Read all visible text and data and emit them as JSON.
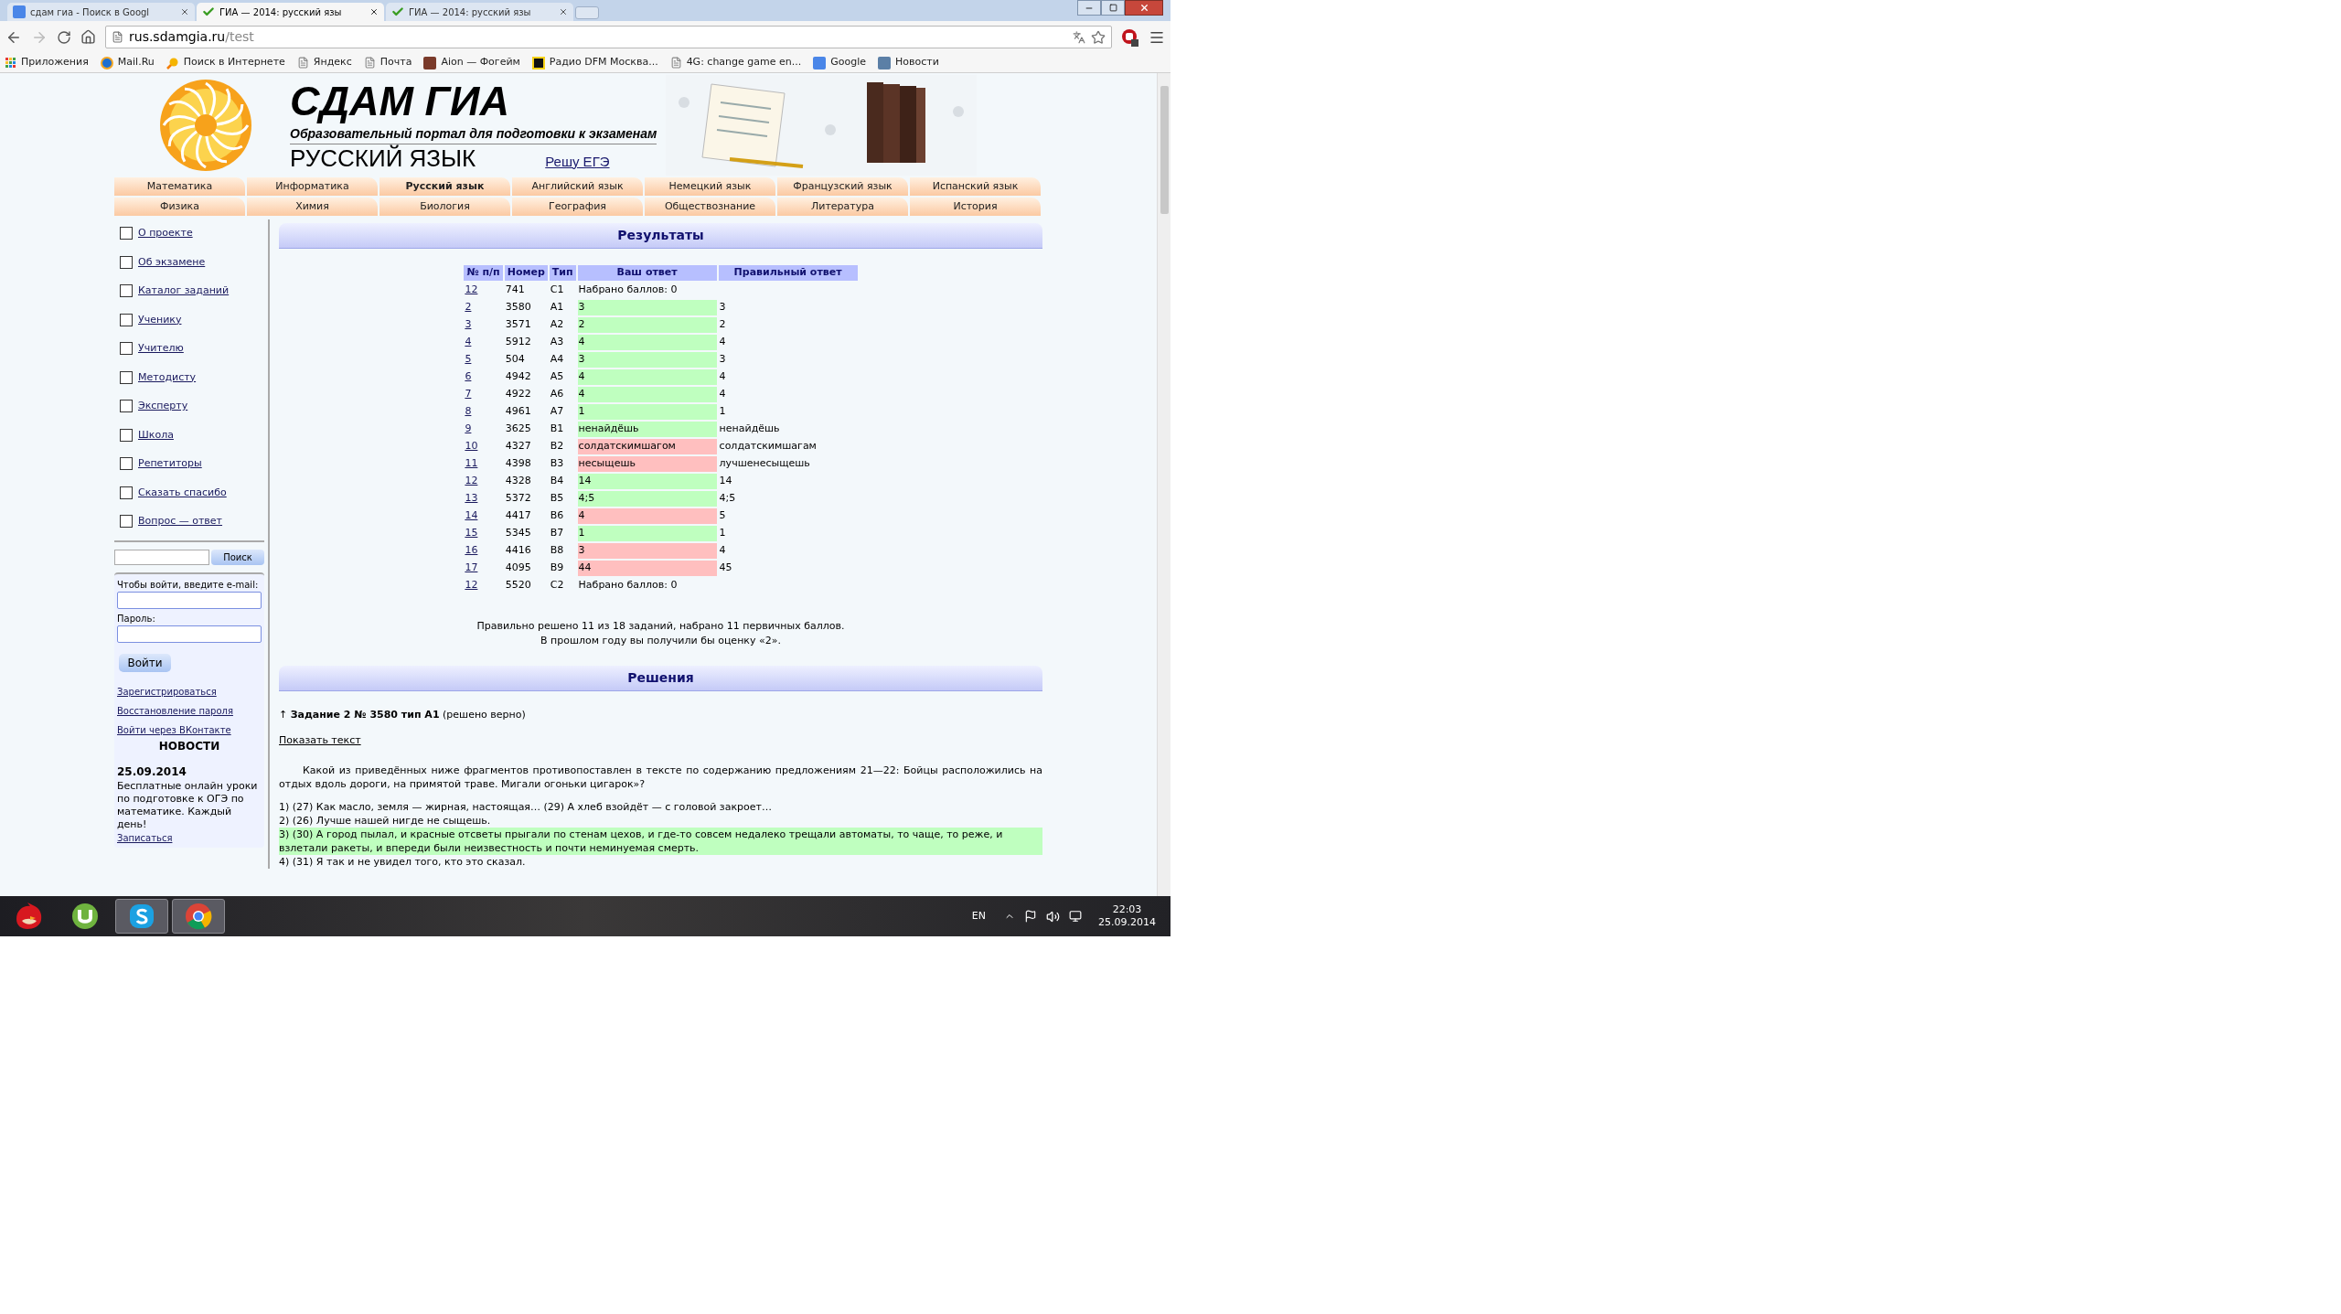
{
  "browser": {
    "tabs": [
      {
        "title": "сдам гиа - Поиск в Googl",
        "kind": "google",
        "selected": false
      },
      {
        "title": "ГИА — 2014: русский язы",
        "kind": "check",
        "selected": true
      },
      {
        "title": "ГИА — 2014: русский язы",
        "kind": "check",
        "selected": false
      }
    ],
    "url_host": "rus.sdamgia.ru",
    "url_path": "/test",
    "bookmarks": [
      {
        "label": "Приложения",
        "kind": "apps"
      },
      {
        "label": "Mail.Ru",
        "kind": "mail"
      },
      {
        "label": "Поиск в Интернете",
        "kind": "search"
      },
      {
        "label": "Яндекс",
        "kind": "page"
      },
      {
        "label": "Почта",
        "kind": "page"
      },
      {
        "label": "Aion — Фогейм",
        "kind": "game"
      },
      {
        "label": "Радио DFM Москва...",
        "kind": "radio"
      },
      {
        "label": "4G: change game en...",
        "kind": "page"
      },
      {
        "label": "Google",
        "kind": "google"
      },
      {
        "label": "Новости",
        "kind": "vk"
      }
    ]
  },
  "header": {
    "title": "СДАМ ГИА",
    "subtitle": "Образовательный портал для подготовки к экзаменам",
    "subject": "РУССКИЙ ЯЗЫК",
    "link": "Решу ЕГЭ"
  },
  "nav": [
    [
      {
        "label": "Математика",
        "selected": false
      },
      {
        "label": "Информатика",
        "selected": false
      },
      {
        "label": "Русский язык",
        "selected": true
      },
      {
        "label": "Английский язык",
        "selected": false
      },
      {
        "label": "Немецкий язык",
        "selected": false
      },
      {
        "label": "Французский язык",
        "selected": false
      },
      {
        "label": "Испанский язык",
        "selected": false
      }
    ],
    [
      {
        "label": "Физика",
        "selected": false
      },
      {
        "label": "Химия",
        "selected": false
      },
      {
        "label": "Биология",
        "selected": false
      },
      {
        "label": "География",
        "selected": false
      },
      {
        "label": "Обществознание",
        "selected": false
      },
      {
        "label": "Литература",
        "selected": false
      },
      {
        "label": "История",
        "selected": false
      }
    ]
  ],
  "sidebar": {
    "menu": [
      {
        "label": "О проекте",
        "checked": false
      },
      {
        "label": "Об экзамене",
        "checked": false
      },
      {
        "label": "Каталог заданий",
        "checked": false
      },
      {
        "label": "Ученику",
        "checked": false
      },
      {
        "label": "Учителю",
        "checked": false
      },
      {
        "label": "Методисту",
        "checked": false
      },
      {
        "label": "Эксперту",
        "checked": false
      },
      {
        "label": "Школа",
        "checked": false
      },
      {
        "label": "Репетиторы",
        "checked": false
      },
      {
        "label": "Сказать спасибо",
        "checked": false
      },
      {
        "label": "Вопрос — ответ",
        "checked": false
      }
    ],
    "search_button": "Поиск",
    "login": {
      "prompt": "Чтобы войти, введите e-mail:",
      "password_label": "Пароль:",
      "button": "Войти",
      "links": [
        "Зарегистрироваться",
        "Восстановление пароля",
        "Войти через ВКонтакте"
      ]
    },
    "news": {
      "title": "НОВОСТИ",
      "date": "25.09.2014",
      "text": "Бесплатные онлайн уроки по подготовке к ОГЭ по математике. Каждый день!",
      "link": "Записаться"
    }
  },
  "results": {
    "title": "Результаты",
    "columns": [
      "№ п/п",
      "Номер",
      "Тип",
      "Ваш ответ",
      "Правильный ответ"
    ],
    "rows": [
      {
        "index": "12",
        "number": "741",
        "type": "C1",
        "answer": "Набрано баллов: 0",
        "kind": "score"
      },
      {
        "index": "2",
        "number": "3580",
        "type": "A1",
        "answer": "3",
        "correct": "3",
        "kind": "right"
      },
      {
        "index": "3",
        "number": "3571",
        "type": "A2",
        "answer": "2",
        "correct": "2",
        "kind": "right"
      },
      {
        "index": "4",
        "number": "5912",
        "type": "A3",
        "answer": "4",
        "correct": "4",
        "kind": "right"
      },
      {
        "index": "5",
        "number": "504",
        "type": "A4",
        "answer": "3",
        "correct": "3",
        "kind": "right"
      },
      {
        "index": "6",
        "number": "4942",
        "type": "A5",
        "answer": "4",
        "correct": "4",
        "kind": "right"
      },
      {
        "index": "7",
        "number": "4922",
        "type": "A6",
        "answer": "4",
        "correct": "4",
        "kind": "right"
      },
      {
        "index": "8",
        "number": "4961",
        "type": "A7",
        "answer": "1",
        "correct": "1",
        "kind": "right"
      },
      {
        "index": "9",
        "number": "3625",
        "type": "B1",
        "answer": "ненайдёшь",
        "correct": "ненайдёшь",
        "kind": "right"
      },
      {
        "index": "10",
        "number": "4327",
        "type": "B2",
        "answer": "солдатскимшагом",
        "correct": "солдатскимшагам",
        "kind": "wrong"
      },
      {
        "index": "11",
        "number": "4398",
        "type": "B3",
        "answer": "несыщешь",
        "correct": "лучшенесыщешь",
        "kind": "wrong"
      },
      {
        "index": "12",
        "number": "4328",
        "type": "B4",
        "answer": "14",
        "correct": "14",
        "kind": "right"
      },
      {
        "index": "13",
        "number": "5372",
        "type": "B5",
        "answer": "4;5",
        "correct": "4;5",
        "kind": "right"
      },
      {
        "index": "14",
        "number": "4417",
        "type": "B6",
        "answer": "4",
        "correct": "5",
        "kind": "wrong"
      },
      {
        "index": "15",
        "number": "5345",
        "type": "B7",
        "answer": "1",
        "correct": "1",
        "kind": "right"
      },
      {
        "index": "16",
        "number": "4416",
        "type": "B8",
        "answer": "3",
        "correct": "4",
        "kind": "wrong"
      },
      {
        "index": "17",
        "number": "4095",
        "type": "B9",
        "answer": "44",
        "correct": "45",
        "kind": "wrong"
      },
      {
        "index": "12",
        "number": "5520",
        "type": "C2",
        "answer": "Набрано баллов: 0",
        "kind": "score"
      }
    ],
    "summary": [
      "Правильно решено 11 из 18 заданий, набрано 11 первичных баллов.",
      "В прошлом году вы получили бы оценку «2»."
    ]
  },
  "solutions": {
    "title": "Решения",
    "task": "↑ **Задание 2 № 3580 тип A1** (решено верно)",
    "show_text": "Показать текст",
    "question": "Какой из приведённых ниже фрагментов противопоставлен в тексте по содержанию предложениям 21—22: Бойцы расположились на отдых вдоль дороги, на примятой траве. Мигали огоньки цигарок»?",
    "options": [
      {
        "text": "1) (27) Как масло, земля — жирная, настоящая… (29) А хлеб взойдёт — с головой закроет…",
        "selected": false
      },
      {
        "text": "2) (26) Лучше нашей нигде не сыщешь.",
        "selected": false
      },
      {
        "text": "3) (30) А город пылал, и красные отсветы прыгали по стенам цехов, и где-то совсем недалеко трещали автоматы, то чаще, то реже, и взлетали ракеты, и впереди были неизвестность и почти неминуемая смерть.",
        "selected": true
      },
      {
        "text": "4) (31) Я так и не увидел того, кто это сказал.",
        "selected": false
      }
    ]
  },
  "taskbar": {
    "apps": [
      {
        "kind": "bird",
        "selected": false
      },
      {
        "kind": "torrent",
        "selected": false
      },
      {
        "kind": "skype",
        "selected": true
      },
      {
        "kind": "chrome",
        "selected": true
      }
    ],
    "language": "EN",
    "time": "22:03",
    "date": "25.09.2014"
  }
}
